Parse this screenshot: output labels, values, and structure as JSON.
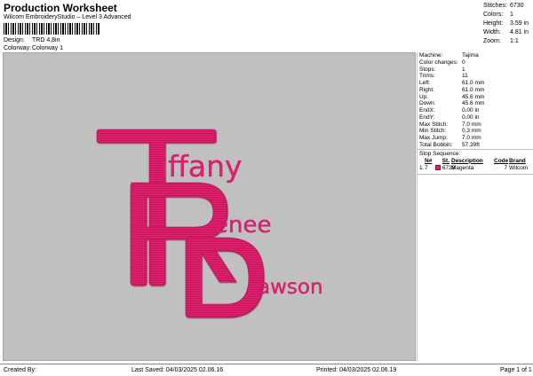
{
  "header": {
    "title": "Production Worksheet",
    "subtitle": "Wilcom EmbroideryStudio – Level 3 Advanced",
    "design_label": "Design:",
    "design_value": "TRD 4,8in",
    "colorway_label": "Colorway:",
    "colorway_value": "Colorway 1"
  },
  "summary": [
    {
      "label": "Stitches:",
      "value": "6730"
    },
    {
      "label": "Colors:",
      "value": "1"
    },
    {
      "label": "Height:",
      "value": "3.59 in"
    },
    {
      "label": "Width:",
      "value": "4.81 in"
    },
    {
      "label": "Zoom:",
      "value": "1:1"
    }
  ],
  "design": {
    "thread_color": "#e0206f",
    "canvas_color": "#c0c0c0",
    "letters": [
      "T",
      "R",
      "D"
    ],
    "words": [
      "iffany",
      "enee",
      "awson"
    ]
  },
  "machine_info": [
    {
      "label": "Machine:",
      "value": "Tajima"
    },
    {
      "label": "Color changes:",
      "value": "0"
    },
    {
      "label": "Stops:",
      "value": "1"
    },
    {
      "label": "Trims:",
      "value": "11"
    },
    {
      "label": "Left:",
      "value": "61.0 mm"
    },
    {
      "label": "Right:",
      "value": "61.0 mm"
    },
    {
      "label": "Up:",
      "value": "45.6 mm"
    },
    {
      "label": "Down:",
      "value": "45.6 mm"
    },
    {
      "label": "EndX:",
      "value": "0.00 in"
    },
    {
      "label": "EndY:",
      "value": "0.00 in"
    },
    {
      "label": "Max Stitch:",
      "value": "7.0 mm"
    },
    {
      "label": "Min Stitch:",
      "value": "0.3 mm"
    },
    {
      "label": "Max Jump:",
      "value": "7.0 mm"
    },
    {
      "label": "Total Bobbin:",
      "value": "57.39ft"
    }
  ],
  "stop_sequence": {
    "title": "Stop Sequence:",
    "headers": {
      "n": "N#",
      "st": "St.",
      "desc": "Description",
      "code": "Code",
      "brand": "Brand"
    },
    "rows": [
      {
        "index": "1.",
        "n": "7",
        "st": "6728",
        "desc": "Magenta",
        "code": "7",
        "brand": "Wilcom"
      }
    ]
  },
  "footer": {
    "created": "Created By:",
    "saved": "Last Saved: 04/03/2025 02.06.16",
    "printed": "Printed: 04/03/2025 02.06.19",
    "page": "Page 1 of 1"
  }
}
